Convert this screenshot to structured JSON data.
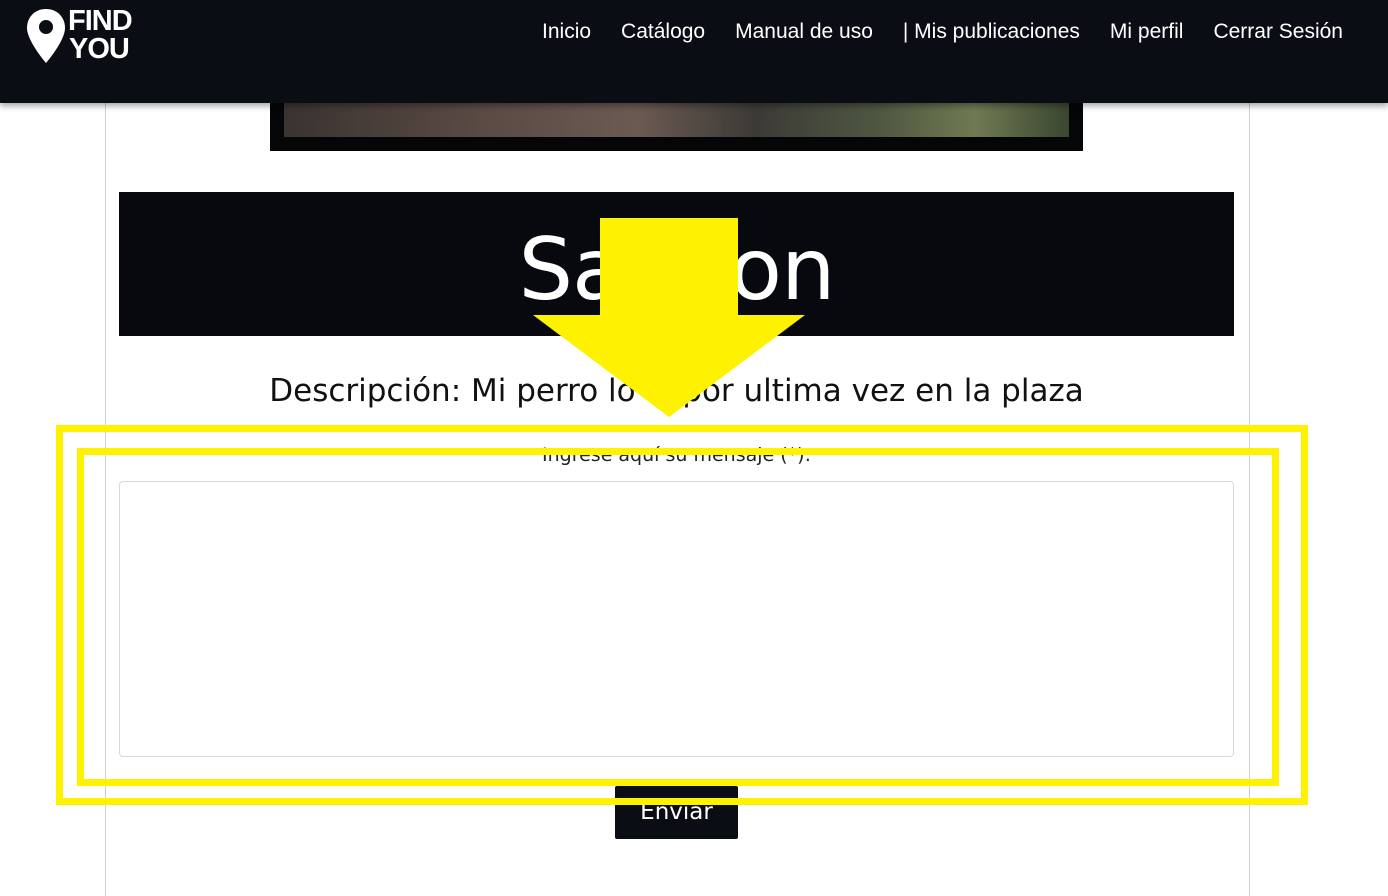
{
  "brand": {
    "line1": "FIND",
    "line2": "YOU"
  },
  "nav": {
    "items": [
      {
        "label": "Inicio"
      },
      {
        "label": "Catálogo"
      },
      {
        "label": "Manual de uso"
      },
      {
        "label": "| Mis publicaciones"
      },
      {
        "label": "Mi perfil"
      },
      {
        "label": "Cerrar Sesión"
      }
    ]
  },
  "post": {
    "title": "Salmon",
    "description": "Descripción: Mi perro lo vi por ultima vez en la plaza"
  },
  "form": {
    "message_label": "Ingrese aquí su mensaje (*):",
    "message_value": "",
    "send_label": "Enviar"
  },
  "colors": {
    "navbar": "#0b0d14",
    "annotation": "#fff200"
  },
  "icons": {
    "logo": "location-pin-icon",
    "annotation": "arrow-down-icon"
  }
}
